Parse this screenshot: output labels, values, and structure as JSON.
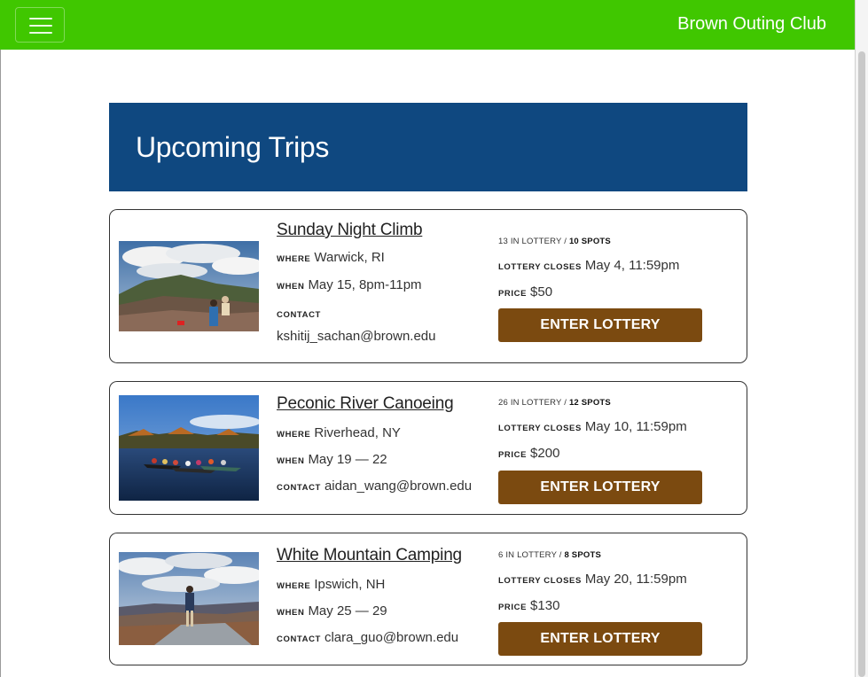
{
  "navbar": {
    "brand": "Brown Outing Club",
    "menu_icon": "hamburger-menu-icon",
    "color": "#40c700"
  },
  "hero": {
    "title": "Upcoming Trips",
    "color": "#0f4880"
  },
  "labels": {
    "where": "where",
    "when": "when",
    "contact": "contact",
    "lottery_closes": "lottery closes",
    "price": "price",
    "in_lottery": "in lottery /",
    "spots": "spots",
    "enter_lottery": "Enter Lottery"
  },
  "trips": [
    {
      "title": "Sunday Night Climb",
      "where": "Warwick, RI",
      "when": "May 15, 8pm-11pm",
      "contact": "kshitij_sachan@brown.edu",
      "in_lottery": "13",
      "spots": "10",
      "lottery_closes": "May 4, 11:59pm",
      "price": "$50",
      "image": "mountain-summit-photo"
    },
    {
      "title": "Peconic River Canoeing",
      "where": "Riverhead, NY",
      "when": "May 19 — 22",
      "contact": "aidan_wang@brown.edu",
      "in_lottery": "26",
      "spots": "12",
      "lottery_closes": "May 10, 11:59pm",
      "price": "$200",
      "image": "lake-canoes-photo"
    },
    {
      "title": "White Mountain Camping",
      "where": "Ipswich, NH",
      "when": "May 25 — 29",
      "contact": "clara_guo@brown.edu",
      "in_lottery": "6",
      "spots": "8",
      "lottery_closes": "May 20, 11:59pm",
      "price": "$130",
      "image": "hiker-overlook-photo"
    }
  ],
  "colors": {
    "button": "#7b4a10",
    "card_border": "#333333"
  }
}
